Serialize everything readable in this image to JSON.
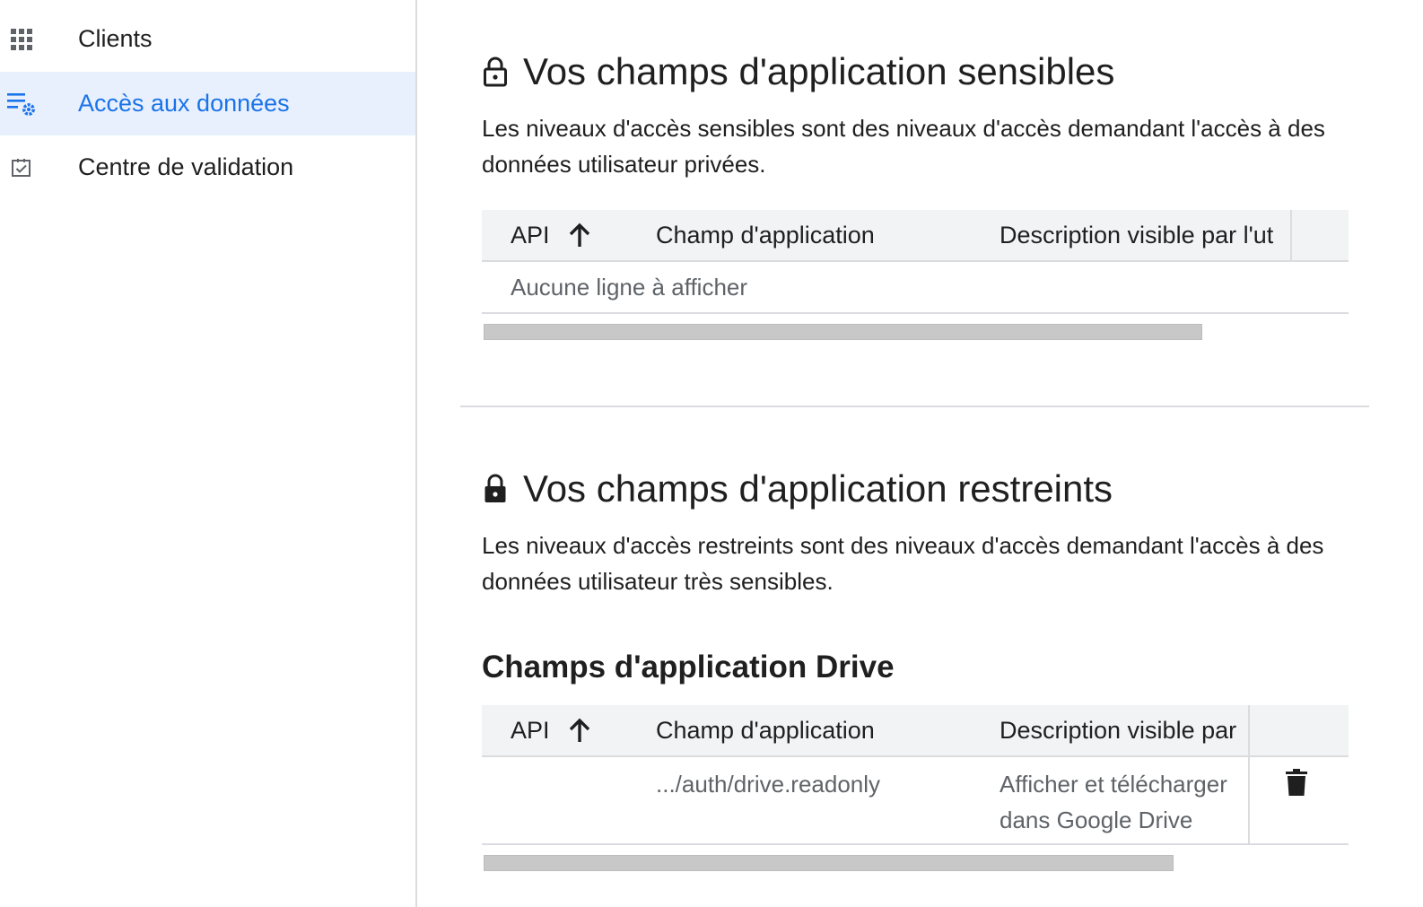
{
  "sidebar": {
    "items": [
      {
        "label": "Clients",
        "icon": "apps-grid-icon",
        "active": false
      },
      {
        "label": "Accès aux données",
        "icon": "data-access-settings-icon",
        "active": true
      },
      {
        "label": "Centre de validation",
        "icon": "checkbox-icon",
        "active": false
      }
    ]
  },
  "sensitive": {
    "title": "Vos champs d'application sensibles",
    "description": "Les niveaux d'accès sensibles sont des niveaux d'accès demandant l'accès à des données utilisateur privées.",
    "table": {
      "columns": [
        "API",
        "Champ d'application",
        "Description visible par l'ut"
      ],
      "empty_message": "Aucune ligne à afficher"
    }
  },
  "restricted": {
    "title": "Vos champs d'application restreints",
    "description": "Les niveaux d'accès restreints sont des niveaux d'accès demandant l'accès à des données utilisateur très sensibles.",
    "drive": {
      "title": "Champs d'application Drive",
      "table": {
        "columns": [
          "API",
          "Champ d'application",
          "Description visible par"
        ],
        "rows": [
          {
            "api": "",
            "scope": ".../auth/drive.readonly",
            "description_line1": "Afficher et télécharger",
            "description_line2": "dans Google Drive"
          }
        ]
      }
    }
  },
  "colors": {
    "accent": "#1a73e8",
    "active_bg": "#e8f0fe",
    "header_bg": "#f1f3f4",
    "divider": "#dadce0",
    "muted_text": "#5f6368"
  }
}
